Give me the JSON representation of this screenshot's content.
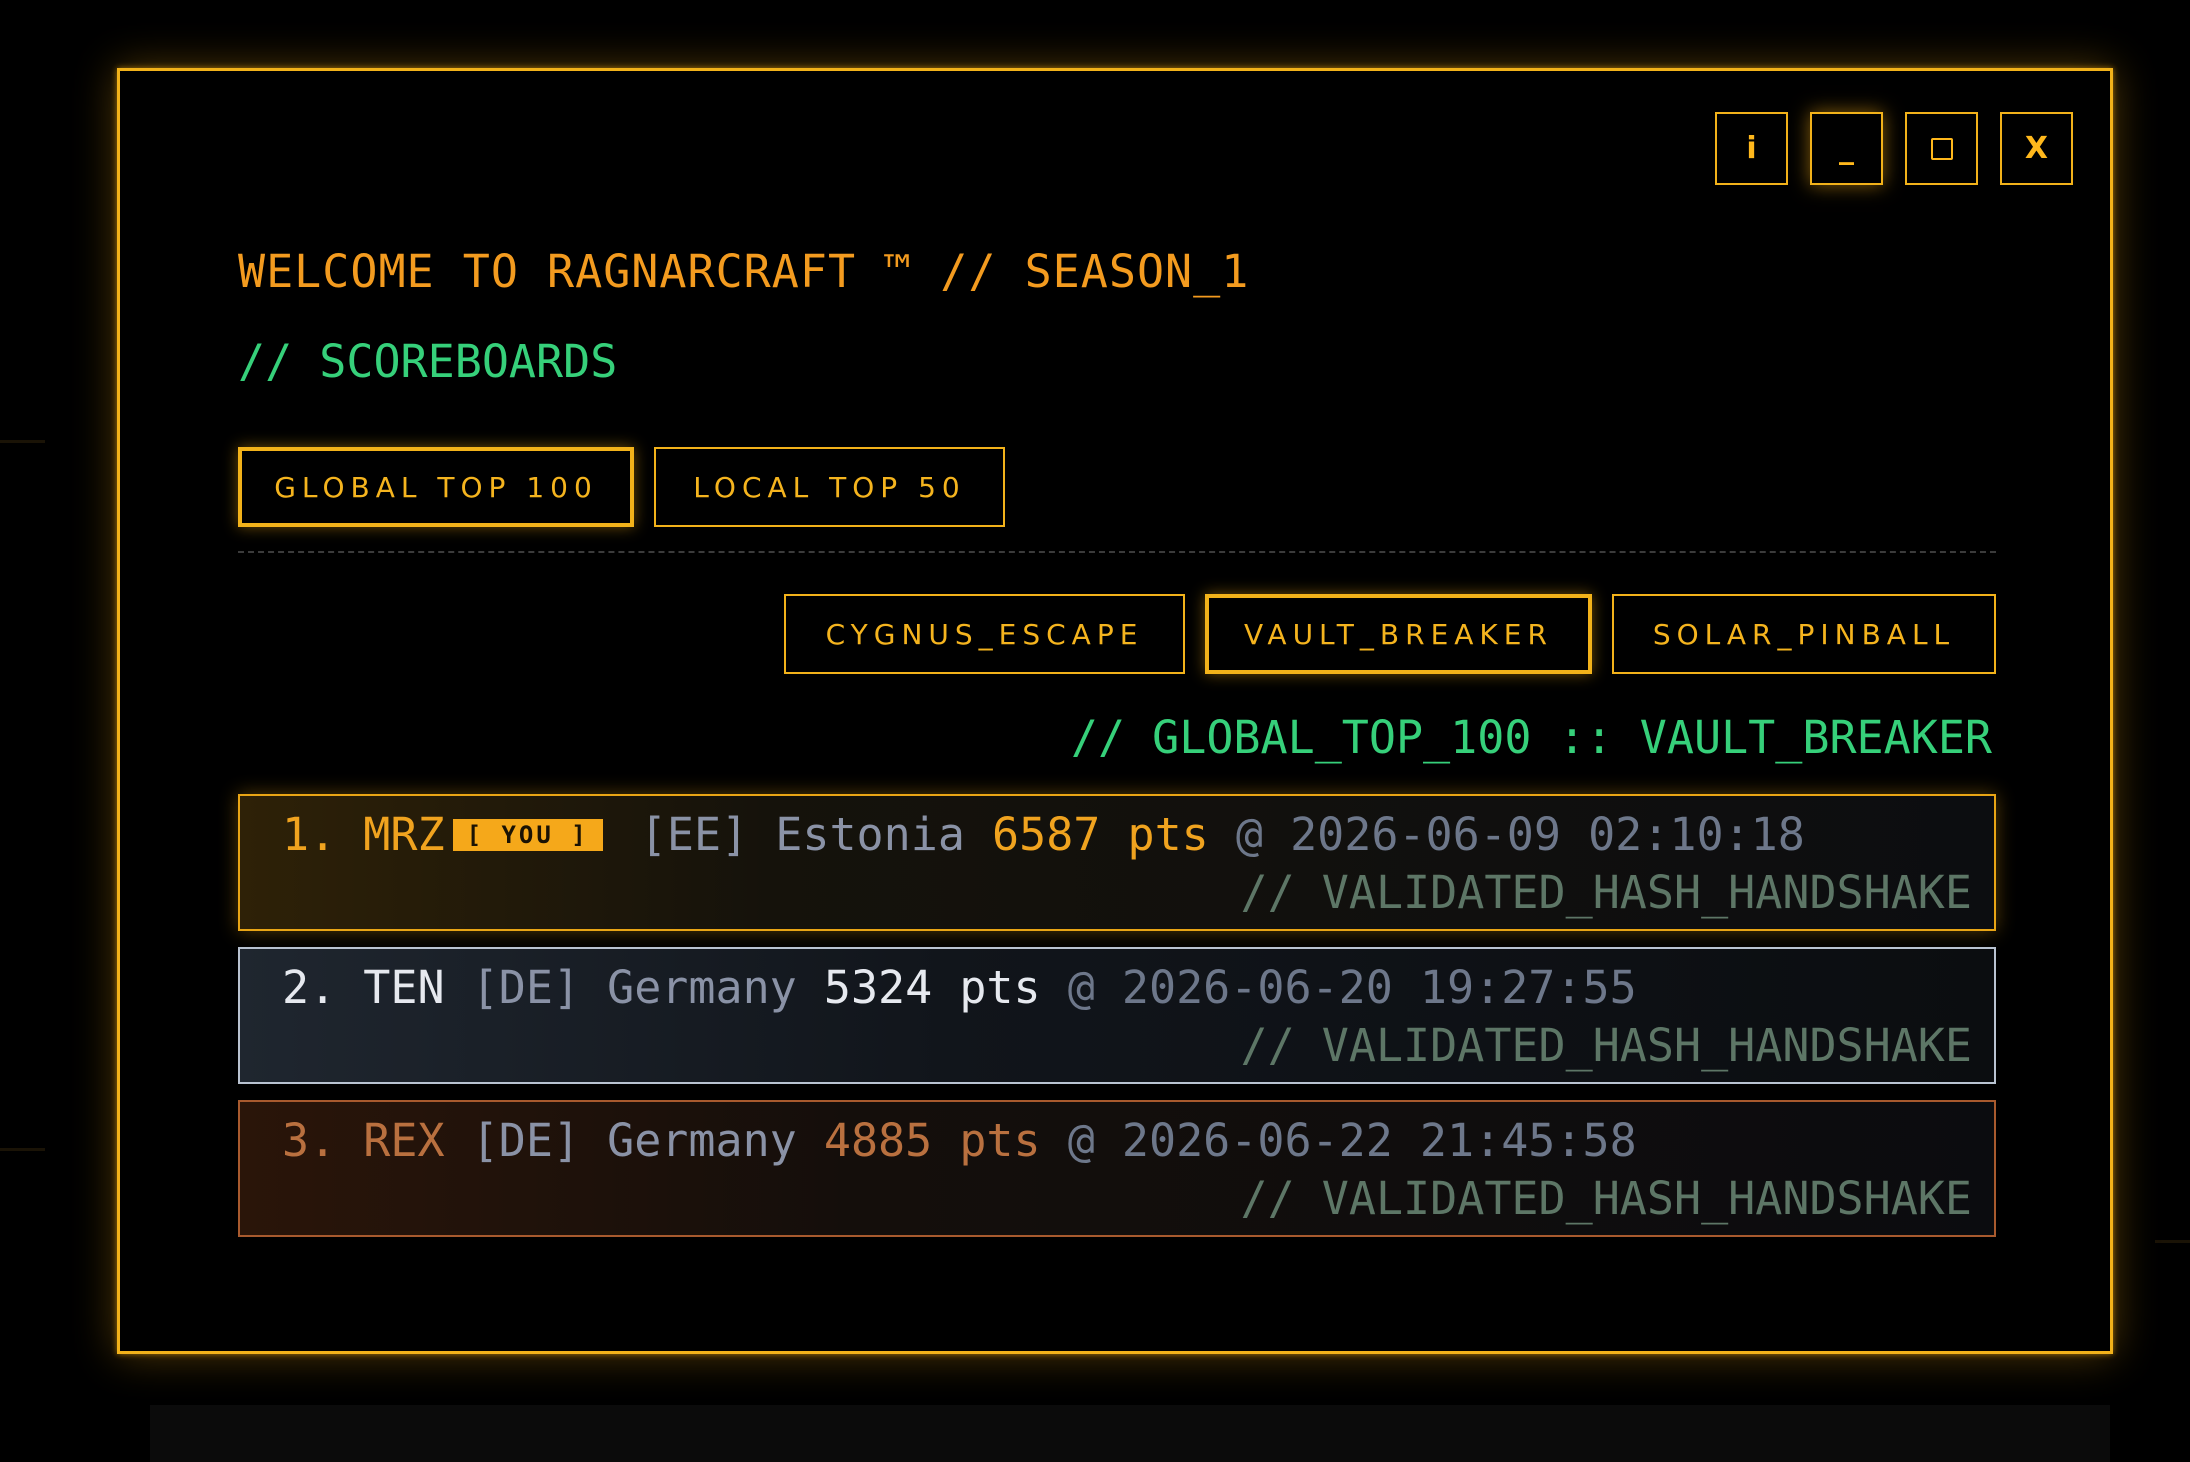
{
  "window": {
    "controls": {
      "info_label": "i",
      "minimize_label": "_",
      "close_label": "X"
    }
  },
  "header": {
    "title": "WELCOME TO RAGNARCRAFT ™ // SEASON_1",
    "subtitle": "// SCOREBOARDS"
  },
  "scope_tabs": [
    {
      "label": "GLOBAL TOP 100",
      "active": true
    },
    {
      "label": "LOCAL TOP 50",
      "active": false
    }
  ],
  "game_tabs": [
    {
      "label": "CYGNUS_ESCAPE",
      "active": false
    },
    {
      "label": "VAULT_BREAKER",
      "active": true
    },
    {
      "label": "SOLAR_PINBALL",
      "active": false
    }
  ],
  "board_label": "// GLOBAL_TOP_100 :: VAULT_BREAKER",
  "entries": [
    {
      "rank": "1.",
      "name": "MRZ",
      "you_badge": "[ YOU ]",
      "country_code": "[EE]",
      "country": "Estonia",
      "score": "6587 pts",
      "at": "@",
      "timestamp": "2026-06-09 02:10:18",
      "validation": "// VALIDATED_HASH_HANDSHAKE"
    },
    {
      "rank": "2.",
      "name": "TEN",
      "country_code": "[DE]",
      "country": "Germany",
      "score": "5324 pts",
      "at": "@",
      "timestamp": "2026-06-20 19:27:55",
      "validation": "// VALIDATED_HASH_HANDSHAKE"
    },
    {
      "rank": "3.",
      "name": "REX",
      "country_code": "[DE]",
      "country": "Germany",
      "score": "4885 pts",
      "at": "@",
      "timestamp": "2026-06-22 21:45:58",
      "validation": "// VALIDATED_HASH_HANDSHAKE"
    }
  ],
  "colors": {
    "accent": "#f2b21a",
    "title": "#f39b1f",
    "terminal_green": "#36d07a",
    "gold": "#f0a31f",
    "silver": "#e6e9ef",
    "bronze": "#b9703f"
  }
}
